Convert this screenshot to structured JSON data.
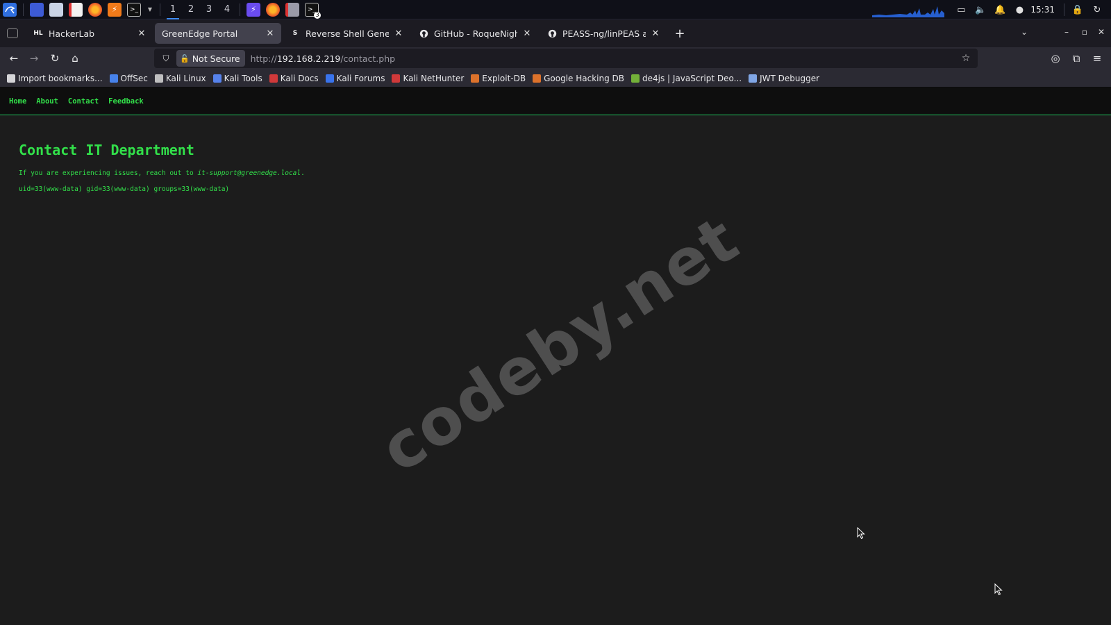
{
  "panel": {
    "workspaces": [
      "1",
      "2",
      "3",
      "4"
    ],
    "active_workspace": "1",
    "clock": "15:31",
    "terminal_badge": "3"
  },
  "browser": {
    "tabs": [
      {
        "label": "HackerLab",
        "favicon": "HL",
        "active": false
      },
      {
        "label": "GreenEdge Portal",
        "favicon": "",
        "active": true
      },
      {
        "label": "Reverse Shell Generator",
        "favicon": "S",
        "active": false
      },
      {
        "label": "GitHub - RoqueNight/Rev",
        "favicon": "github-icon",
        "active": false
      },
      {
        "label": "PEASS-ng/linPEAS at mas",
        "favicon": "github-icon",
        "active": false
      }
    ],
    "not_secure_label": "Not Secure",
    "url_prefix": "http://",
    "url_host": "192.168.2.219",
    "url_path": "/contact.php",
    "bookmarks": [
      {
        "label": "Import bookmarks...",
        "icon": "import-icon",
        "color": "#e8e8ea"
      },
      {
        "label": "OffSec",
        "icon": "offsec-icon",
        "color": "#4a8cff"
      },
      {
        "label": "Kali Linux",
        "icon": "kali-icon",
        "color": "#cfcfcf"
      },
      {
        "label": "Kali Tools",
        "icon": "kali-tools-icon",
        "color": "#5b8cff"
      },
      {
        "label": "Kali Docs",
        "icon": "kali-docs-icon",
        "color": "#e23b3b"
      },
      {
        "label": "Kali Forums",
        "icon": "kali-forums-icon",
        "color": "#3b7bff"
      },
      {
        "label": "Kali NetHunter",
        "icon": "nethunter-icon",
        "color": "#e23b3b"
      },
      {
        "label": "Exploit-DB",
        "icon": "exploitdb-icon",
        "color": "#f07a2a"
      },
      {
        "label": "Google Hacking DB",
        "icon": "ghdb-icon",
        "color": "#f07a2a"
      },
      {
        "label": "de4js | JavaScript Deo...",
        "icon": "de4js-icon",
        "color": "#7bbf3a"
      },
      {
        "label": "JWT Debugger",
        "icon": "jwt-icon",
        "color": "#8ab4f8"
      }
    ]
  },
  "site": {
    "nav": [
      "Home",
      "About",
      "Contact",
      "Feedback"
    ],
    "heading": "Contact IT Department",
    "intro_text": "If you are experiencing issues, reach out to ",
    "email": "it-support@greenedge.local",
    "intro_end": ".",
    "id_output": "uid=33(www-data) gid=33(www-data) groups=33(www-data)"
  },
  "watermark": "codeby.net",
  "colors": {
    "accent_green": "#32e04a",
    "page_bg": "#1c1c1c",
    "browser_chrome": "#2b2a33"
  }
}
